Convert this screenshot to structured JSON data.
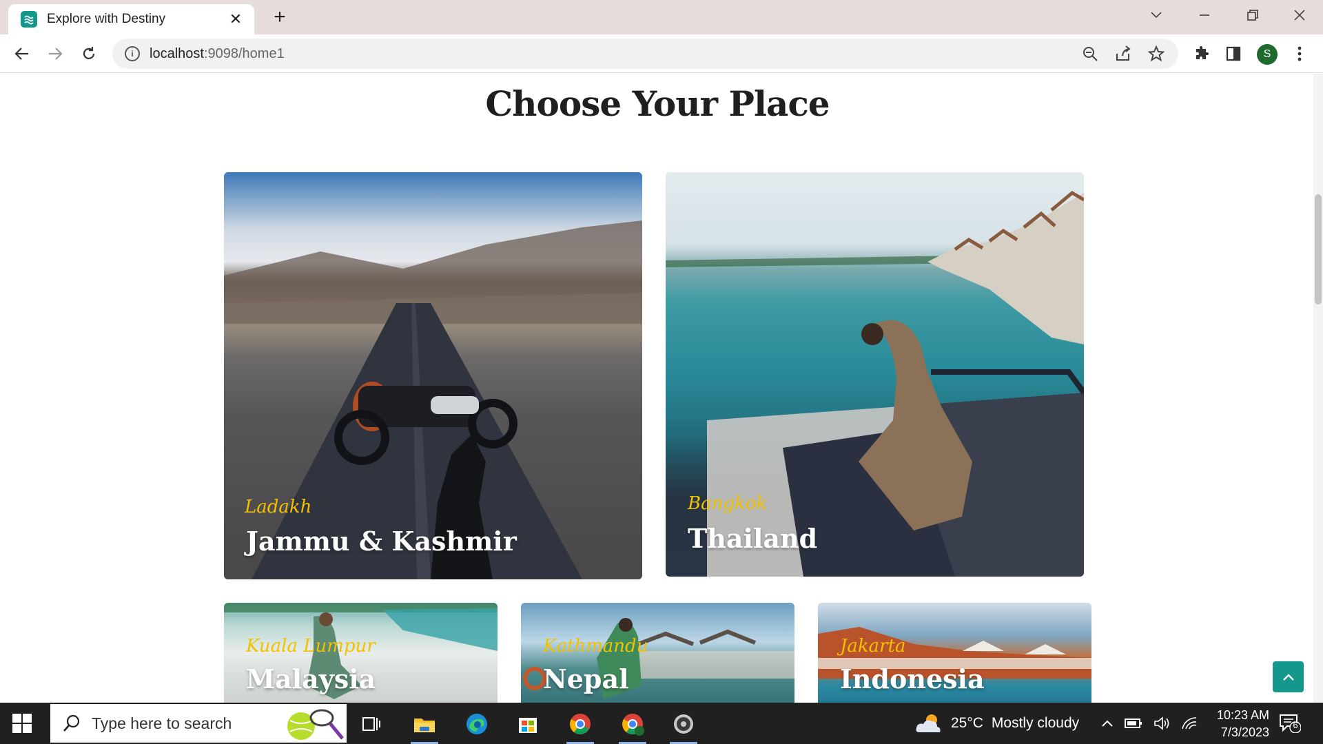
{
  "browser": {
    "tab_title": "Explore with Destiny",
    "url_host": "localhost",
    "url_path": ":9098/home1",
    "profile_initial": "S"
  },
  "page": {
    "heading": "Choose Your Place",
    "cards": [
      {
        "subtitle": "Ladakh",
        "title": "Jammu & Kashmir"
      },
      {
        "subtitle": "Bangkok",
        "title": "Thailand"
      },
      {
        "subtitle": "Kuala Lumpur",
        "title": "Malaysia"
      },
      {
        "subtitle": "Kathmandu",
        "title": "Nepal"
      },
      {
        "subtitle": "Jakarta",
        "title": "Indonesia"
      }
    ]
  },
  "taskbar": {
    "search_placeholder": "Type here to search",
    "weather_temp": "25°C",
    "weather_desc": "Mostly cloudy",
    "time": "10:23 AM",
    "date": "7/3/2023",
    "notification_count": "6"
  },
  "colors": {
    "accent": "#14988c",
    "subtitle_yellow": "#f2c200"
  }
}
